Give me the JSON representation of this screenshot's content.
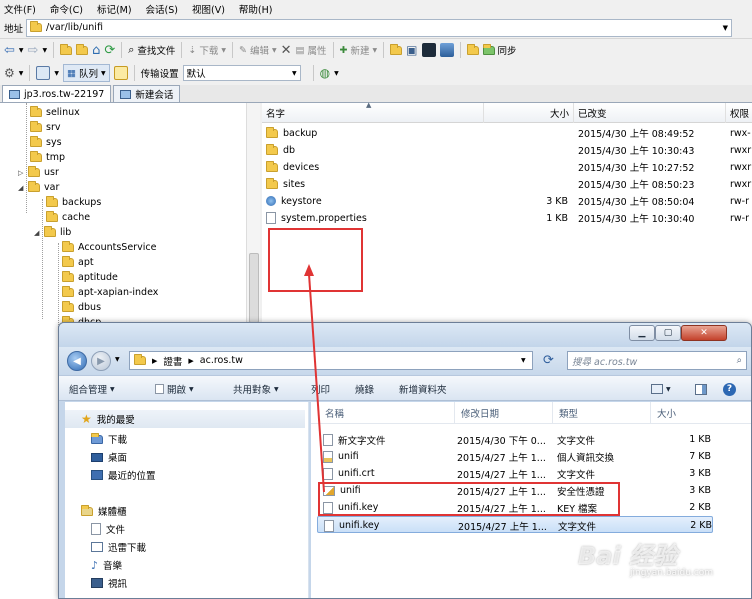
{
  "menu": [
    "文件(F)",
    "命令(C)",
    "标记(M)",
    "会话(S)",
    "视图(V)",
    "帮助(H)"
  ],
  "address": {
    "label": "地址",
    "path": "/var/lib/unifi"
  },
  "toolbar1": {
    "find_files": "查找文件",
    "download": "下载",
    "edit": "编辑",
    "properties": "属性",
    "new": "新建",
    "sync": "同步"
  },
  "toolbar2": {
    "queue": "队列",
    "transfer_settings_label": "传输设置",
    "transfer_settings_value": "默认"
  },
  "tabs": [
    {
      "label": "jp3.ros.tw-22197"
    },
    {
      "label": "新建会话"
    }
  ],
  "tree": [
    {
      "label": "selinux"
    },
    {
      "label": "srv"
    },
    {
      "label": "sys"
    },
    {
      "label": "tmp"
    },
    {
      "label": "usr"
    },
    {
      "label": "var"
    },
    {
      "label": "backups"
    },
    {
      "label": "cache"
    },
    {
      "label": "lib"
    },
    {
      "label": "AccountsService"
    },
    {
      "label": "apt"
    },
    {
      "label": "aptitude"
    },
    {
      "label": "apt-xapian-index"
    },
    {
      "label": "dbus"
    },
    {
      "label": "dhcp"
    }
  ],
  "file_list": {
    "columns": {
      "name": "名字",
      "size": "大小",
      "modified": "已改变",
      "perm": "权限"
    },
    "rows": [
      {
        "name": "backup",
        "size": "",
        "modified": "2015/4/30 上午 08:49:52",
        "perm": "rwx-"
      },
      {
        "name": "db",
        "size": "",
        "modified": "2015/4/30 上午 10:30:43",
        "perm": "rwxr"
      },
      {
        "name": "devices",
        "size": "",
        "modified": "2015/4/30 上午 10:27:52",
        "perm": "rwxr"
      },
      {
        "name": "sites",
        "size": "",
        "modified": "2015/4/30 上午 08:50:23",
        "perm": "rwxr"
      },
      {
        "name": "keystore",
        "size": "3 KB",
        "modified": "2015/4/30 上午 08:50:04",
        "perm": "rw-r"
      },
      {
        "name": "system.properties",
        "size": "1 KB",
        "modified": "2015/4/30 上午 10:30:40",
        "perm": "rw-r"
      }
    ]
  },
  "explorer": {
    "path": [
      "證書",
      "ac.ros.tw"
    ],
    "search_placeholder": "搜尋 ac.ros.tw",
    "commands": {
      "organize": "組合管理",
      "open": "開啟",
      "share": "共用對象",
      "print": "列印",
      "burn": "燒錄",
      "new_folder": "新增資料夾"
    },
    "nav": {
      "favorites": "我的最愛",
      "favorites_items": [
        "下載",
        "桌面",
        "最近的位置"
      ],
      "libraries": "媒體櫃",
      "libraries_items": [
        "文件",
        "迅雷下載",
        "音樂",
        "視訊"
      ]
    },
    "columns": {
      "name": "名稱",
      "modified": "修改日期",
      "type": "類型",
      "size": "大小"
    },
    "rows": [
      {
        "name": "新文字文件",
        "modified": "2015/4/30 下午 0...",
        "type": "文字文件",
        "size": "1 KB"
      },
      {
        "name": "unifi",
        "modified": "2015/4/27 上午 1...",
        "type": "個人資訊交換",
        "size": "7 KB"
      },
      {
        "name": "unifi.crt",
        "modified": "2015/4/27 上午 1...",
        "type": "文字文件",
        "size": "3 KB"
      },
      {
        "name": "unifi",
        "modified": "2015/4/27 上午 1...",
        "type": "安全性憑證",
        "size": "3 KB"
      },
      {
        "name": "unifi.key",
        "modified": "2015/4/27 上午 1...",
        "type": "KEY 檔案",
        "size": "2 KB"
      },
      {
        "name": "unifi.key",
        "modified": "2015/4/27 上午 1...",
        "type": "文字文件",
        "size": "2 KB"
      }
    ]
  },
  "watermark": {
    "main": "Bai 经验",
    "sub": "jingyan.baidu.com"
  },
  "colors": {
    "annotation_red": "#e03434",
    "folder_yellow": "#f3c94c",
    "selection_blue": "#c9dff7"
  }
}
